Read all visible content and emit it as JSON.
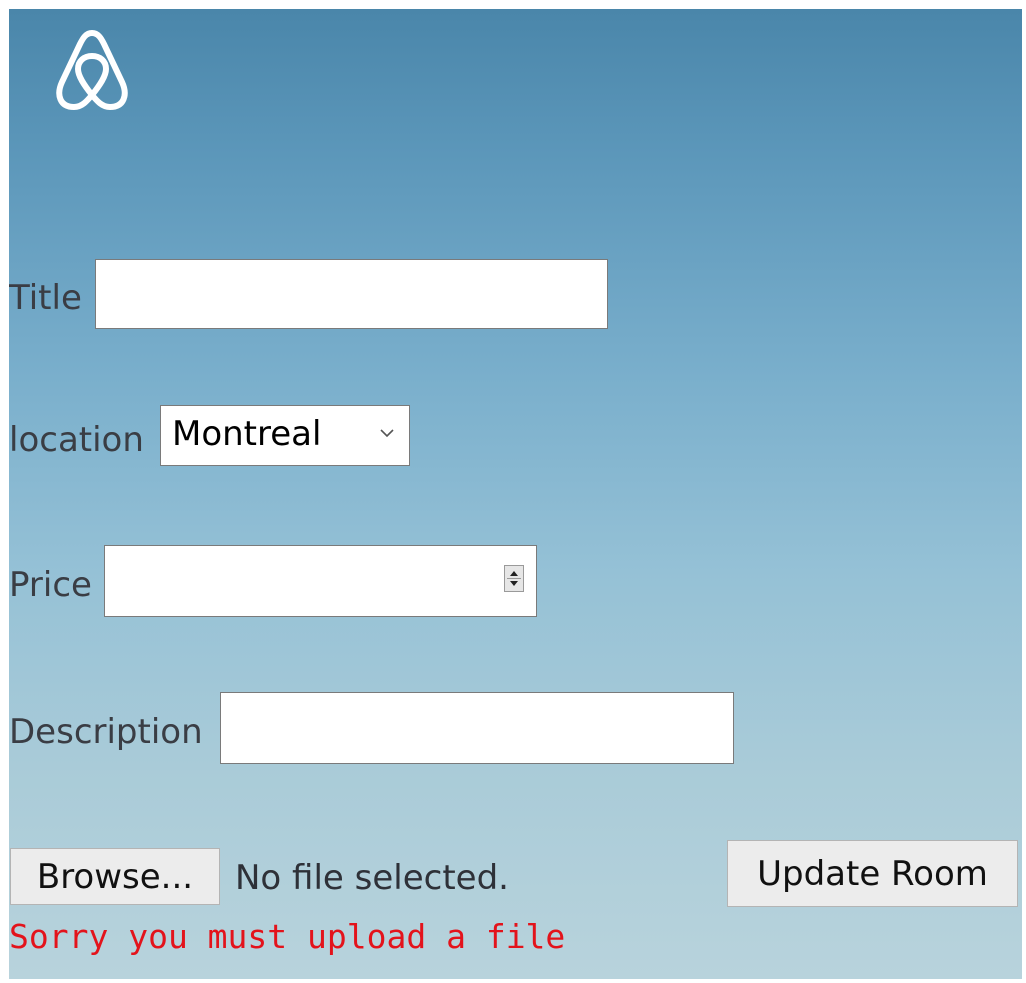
{
  "logo": {
    "icon": "airbnb-logo-icon",
    "color": "#ffffff"
  },
  "form": {
    "title_label": "Title",
    "title_value": "",
    "location_label": "location",
    "location_selected": "Montreal",
    "price_label": "Price",
    "price_value": "",
    "description_label": "Description",
    "description_value": "",
    "browse_label": "Browse...",
    "file_status": "No file selected.",
    "submit_label": "Update Room",
    "error_message": "Sorry you must upload a file"
  },
  "colors": {
    "error": "#e3131b",
    "label": "#3a3d44",
    "sky_top": "#4a86aa",
    "sky_bottom": "#b8d3dc"
  }
}
